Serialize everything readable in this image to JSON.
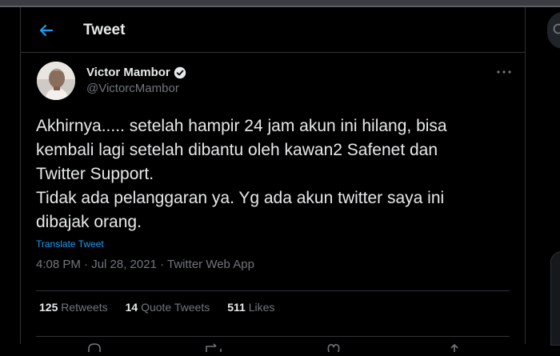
{
  "header": {
    "title": "Tweet"
  },
  "author": {
    "display_name": "Victor Mambor",
    "handle": "@VictorcMambor",
    "verified": true
  },
  "tweet": {
    "text": "Akhirnya..... setelah hampir 24 jam akun ini hilang, bisa\nkembali lagi setelah dibantu oleh kawan2 Safenet dan\nTwitter Support.\nTidak ada pelanggaran ya. Yg ada akun twitter saya ini\ndibajak orang.",
    "translate_label": "Translate Tweet",
    "meta": "4:08 PM · Jul 28, 2021 · Twitter Web App"
  },
  "stats": {
    "retweets_count": "125",
    "retweets_label": "Retweets",
    "quotes_count": "14",
    "quotes_label": "Quote Tweets",
    "likes_count": "511",
    "likes_label": "Likes"
  },
  "icons": [
    "back-arrow-icon",
    "verified-badge-icon",
    "more-icon",
    "search-icon",
    "reply-icon",
    "retweet-icon",
    "like-icon",
    "share-icon"
  ],
  "colors": {
    "background": "#000000",
    "accent": "#1d9bf0",
    "text": "#e7e9ea",
    "muted": "#71767b",
    "border": "#2f3336"
  }
}
